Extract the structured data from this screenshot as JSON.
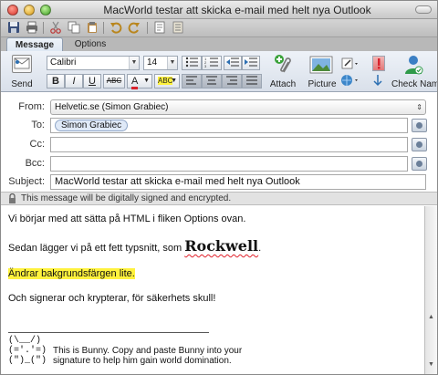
{
  "window": {
    "title": "MacWorld testar att skicka e-mail med helt nya Outlook"
  },
  "quick_toolbar": {
    "icons": [
      "save-icon",
      "print-icon",
      "cut-icon",
      "copy-icon",
      "paste-icon",
      "undo-icon",
      "redo-icon",
      "send-receive-icon",
      "address-book-icon"
    ]
  },
  "tabs": [
    {
      "label": "Message",
      "active": true
    },
    {
      "label": "Options",
      "active": false
    }
  ],
  "ribbon": {
    "send_label": "Send",
    "font_name": "Calibri",
    "font_size": "14",
    "bold": "B",
    "italic": "I",
    "underline": "U",
    "strikethrough": "ABC",
    "font_color_letter": "A",
    "highlight_letters": "ABC",
    "attach_label": "Attach",
    "picture_label": "Picture",
    "check_names_label": "Check Names",
    "colors": {
      "font_color": "#d9232d",
      "highlight": "#fff23d",
      "priority_high": "#d9232d"
    }
  },
  "header": {
    "from_label": "From:",
    "from_value": "Helvetic.se (Simon Grabiec)",
    "to_label": "To:",
    "to_recipient": "Simon Grabiec",
    "cc_label": "Cc:",
    "cc_value": "",
    "bcc_label": "Bcc:",
    "bcc_value": "",
    "subject_label": "Subject:",
    "subject_value": "MacWorld testar att skicka e-mail med helt nya Outlook"
  },
  "security_notice": "This message will be digitally signed and encrypted.",
  "body": {
    "line1": "Vi börjar med att sätta på HTML i fliken Options ovan.",
    "line2_prefix": "Sedan lägger vi på ett fett typsnitt, som ",
    "line2_font_word": "Rockwell",
    "line2_suffix": ".",
    "line3_highlighted": "Ändrar bakgrundsfärgen lite.",
    "line4": "Och signerar och krypterar, för säkerhets skull!",
    "signature": {
      "bunny_ears": "(\\__/)",
      "bunny_face": "(='.'=)",
      "bunny_feet": "(\")_(\")",
      "text_line1": "This is Bunny. Copy and paste Bunny into your",
      "text_line2": "signature to help him gain world domination."
    }
  }
}
